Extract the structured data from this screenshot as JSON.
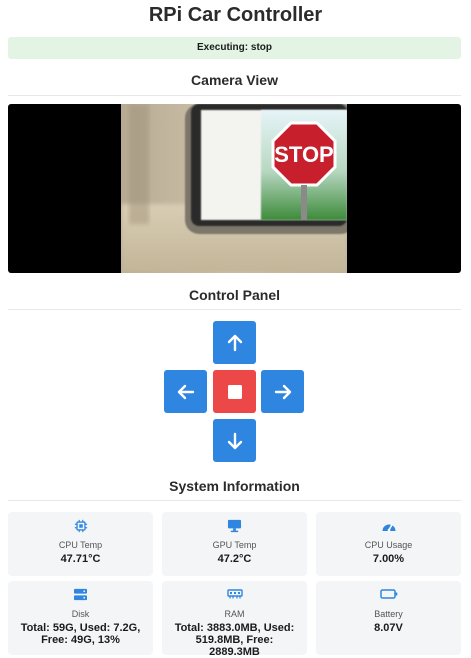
{
  "app": {
    "title": "RPi Car Controller"
  },
  "status": {
    "text": "Executing: stop"
  },
  "camera": {
    "title": "Camera View",
    "sign_text": "STOP"
  },
  "controls": {
    "title": "Control Panel",
    "buttons": {
      "forward": "arrow-up-icon",
      "left": "arrow-left-icon",
      "stop": "stop-square-icon",
      "right": "arrow-right-icon",
      "backward": "arrow-down-icon"
    }
  },
  "system": {
    "title": "System Information",
    "cards": [
      {
        "label": "CPU Temp",
        "value": "47.71°C",
        "icon": "cpu-icon"
      },
      {
        "label": "GPU Temp",
        "value": "47.2°C",
        "icon": "monitor-icon"
      },
      {
        "label": "CPU Usage",
        "value": "7.00%",
        "icon": "gauge-icon"
      },
      {
        "label": "Disk",
        "value": "Total: 59G, Used: 7.2G, Free: 49G, 13%",
        "icon": "hard-drive-icon"
      },
      {
        "label": "RAM",
        "value": "Total: 3883.0MB, Used: 519.8MB, Free: 2889.3MB",
        "icon": "memory-icon"
      },
      {
        "label": "Battery",
        "value": "8.07V",
        "icon": "battery-icon"
      }
    ]
  },
  "colors": {
    "button_blue": "#2f86e0",
    "stop_red": "#ec4848",
    "status_bg": "#e3f3e4",
    "card_bg": "#f3f5f7",
    "icon_blue": "#2f86e0"
  }
}
